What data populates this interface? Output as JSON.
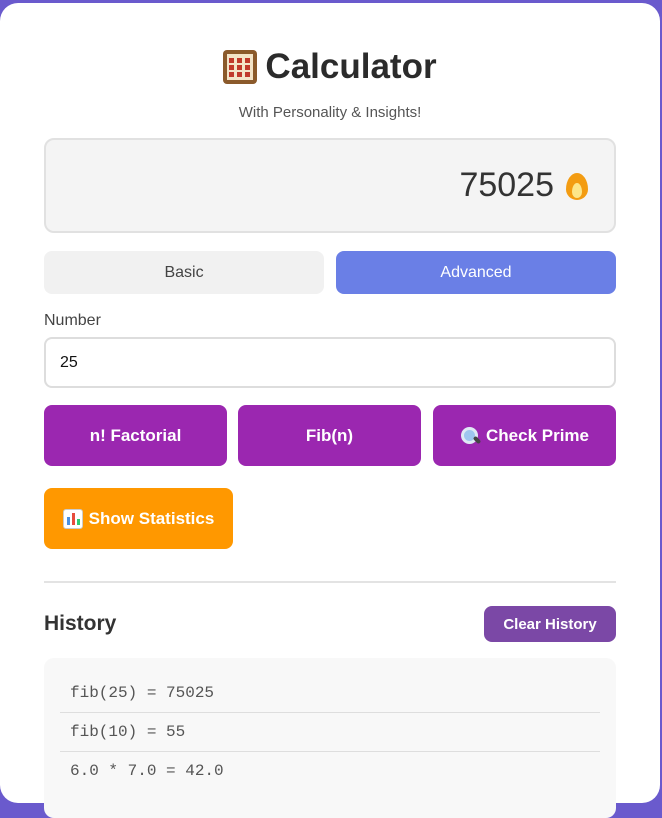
{
  "app": {
    "title": "Calculator",
    "subtitle": "With Personality & Insights!",
    "icon": "abacus-icon"
  },
  "display": {
    "value": "75025",
    "icon": "fire-icon"
  },
  "modes": {
    "basic_label": "Basic",
    "advanced_label": "Advanced",
    "active": "Advanced"
  },
  "input": {
    "label": "Number",
    "value": "25"
  },
  "operations": {
    "factorial_label": "n! Factorial",
    "fibonacci_label": "Fib(n)",
    "prime_label": "Check Prime",
    "prime_icon": "magnifying-glass-icon",
    "stats_label": "Show Statistics",
    "stats_icon": "bar-chart-icon"
  },
  "history": {
    "title": "History",
    "clear_label": "Clear History",
    "items": [
      "fib(25) = 75025",
      "fib(10) = 55",
      "6.0 * 7.0 = 42.0"
    ]
  },
  "colors": {
    "accent": "#6a7fe6",
    "operation": "#9b27b0",
    "stats": "#ff9800",
    "clear": "#7b48a6",
    "background": "#6a5acd"
  }
}
